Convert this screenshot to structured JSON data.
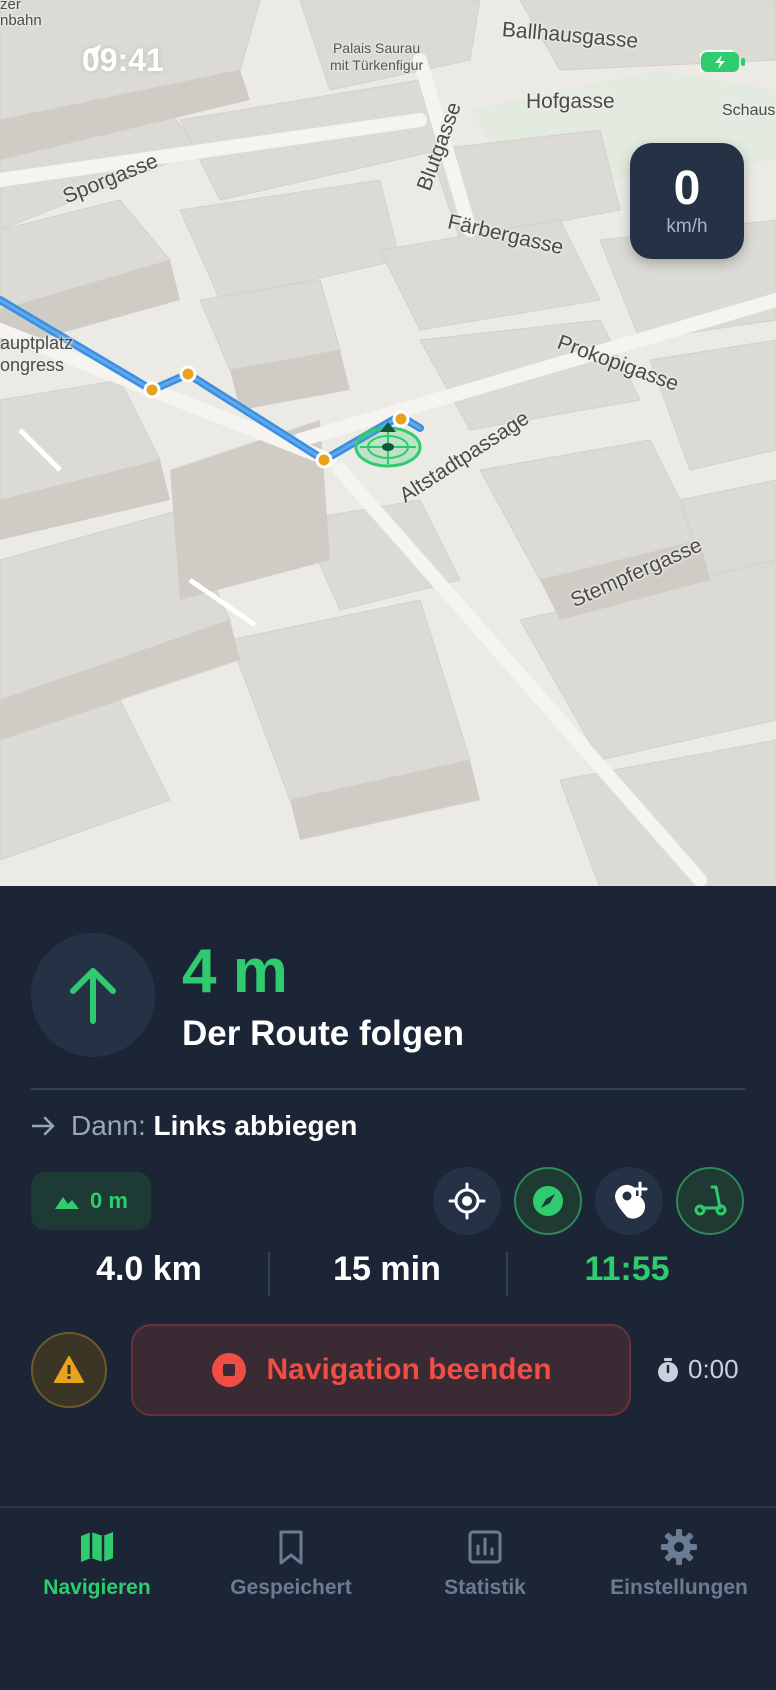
{
  "status_bar": {
    "time": "09:41"
  },
  "map": {
    "speed": {
      "value": "0",
      "unit": "km/h"
    },
    "streets": [
      "Ballhausgasse",
      "Hofgasse",
      "Sporgasse",
      "Blutgasse",
      "Färbergasse",
      "Prokopigasse",
      "Altstadtpassage",
      "Stempfergasse",
      "auptplatz",
      "ongress",
      "Schausp",
      "zer",
      "nbahn"
    ],
    "poi": {
      "line1": "Palais Saurau",
      "line2": "mit Türkenfigur"
    },
    "route_color": "#3b8fe0",
    "waypoint_color": "#e8a21d"
  },
  "navigation": {
    "distance": "4 m",
    "instruction": "Der Route folgen",
    "next_prefix": "Dann:",
    "next_action": "Links abbiegen",
    "elevation": "0 m",
    "controls": [
      "recenter-icon",
      "compass-icon",
      "add-location-icon",
      "scooter-icon"
    ],
    "remaining_distance": "4.0 km",
    "remaining_time": "15 min",
    "arrival_time": "11:55",
    "end_button": "Navigation beenden",
    "timer": "0:00"
  },
  "tabs": [
    {
      "label": "Navigieren",
      "icon": "map-icon",
      "active": true
    },
    {
      "label": "Gespeichert",
      "icon": "bookmark-icon",
      "active": false
    },
    {
      "label": "Statistik",
      "icon": "chart-icon",
      "active": false
    },
    {
      "label": "Einstellungen",
      "icon": "gear-icon",
      "active": false
    }
  ],
  "colors": {
    "accent": "#2ecc6f",
    "danger": "#ee4e44",
    "panel": "#1b2536",
    "chip": "#253246"
  }
}
